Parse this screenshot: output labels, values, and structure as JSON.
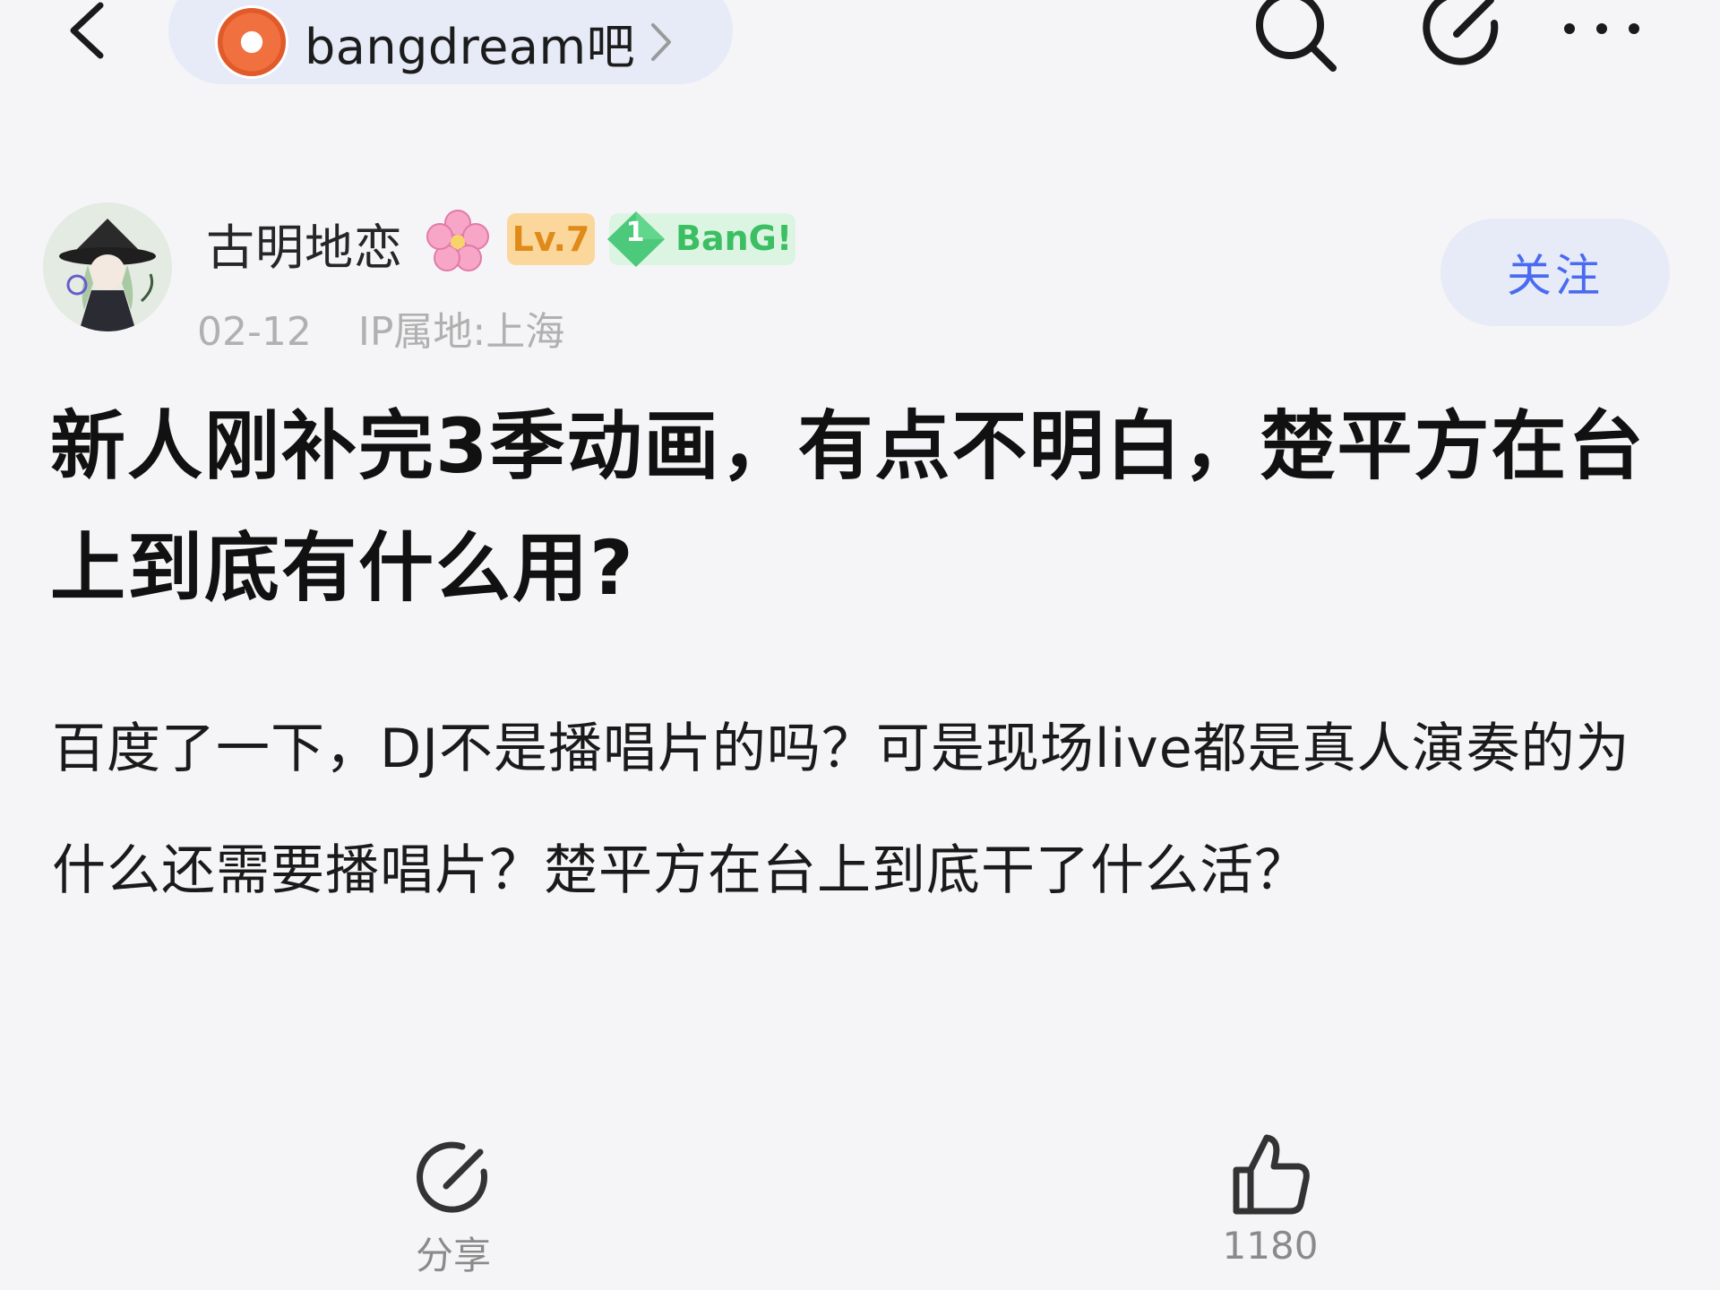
{
  "nav": {
    "forum_name": "bangdream吧"
  },
  "author": {
    "name": "古明地恋",
    "level_badge": "Lv.7",
    "fan_rank": "1",
    "fan_label": "BanG!",
    "date": "02-12",
    "ip_location": "IP属地:上海",
    "follow_label": "关注"
  },
  "post": {
    "title": "新人刚补完3季动画，有点不明白，楚平方在台上到底有什么用?",
    "body": "百度了一下，DJ不是播唱片的吗？可是现场live都是真人演奏的为什么还需要播唱片？楚平方在台上到底干了什么活？"
  },
  "actions": {
    "share_label": "分享",
    "like_count": "1180"
  },
  "icons": {
    "back": "chevron-left-icon",
    "forum_logo": "forum-logo",
    "search": "search-icon",
    "edit": "edit-icon",
    "more": "more-icon",
    "flower": "flower-icon",
    "share": "share-icon",
    "like": "thumbs-up-icon"
  },
  "colors": {
    "accent_blue": "#4a6bf0",
    "pill_bg": "#e6ebf7",
    "level_bg": "#fbd79c",
    "level_text": "#e08a1a",
    "fan_green": "#3cbf62"
  }
}
